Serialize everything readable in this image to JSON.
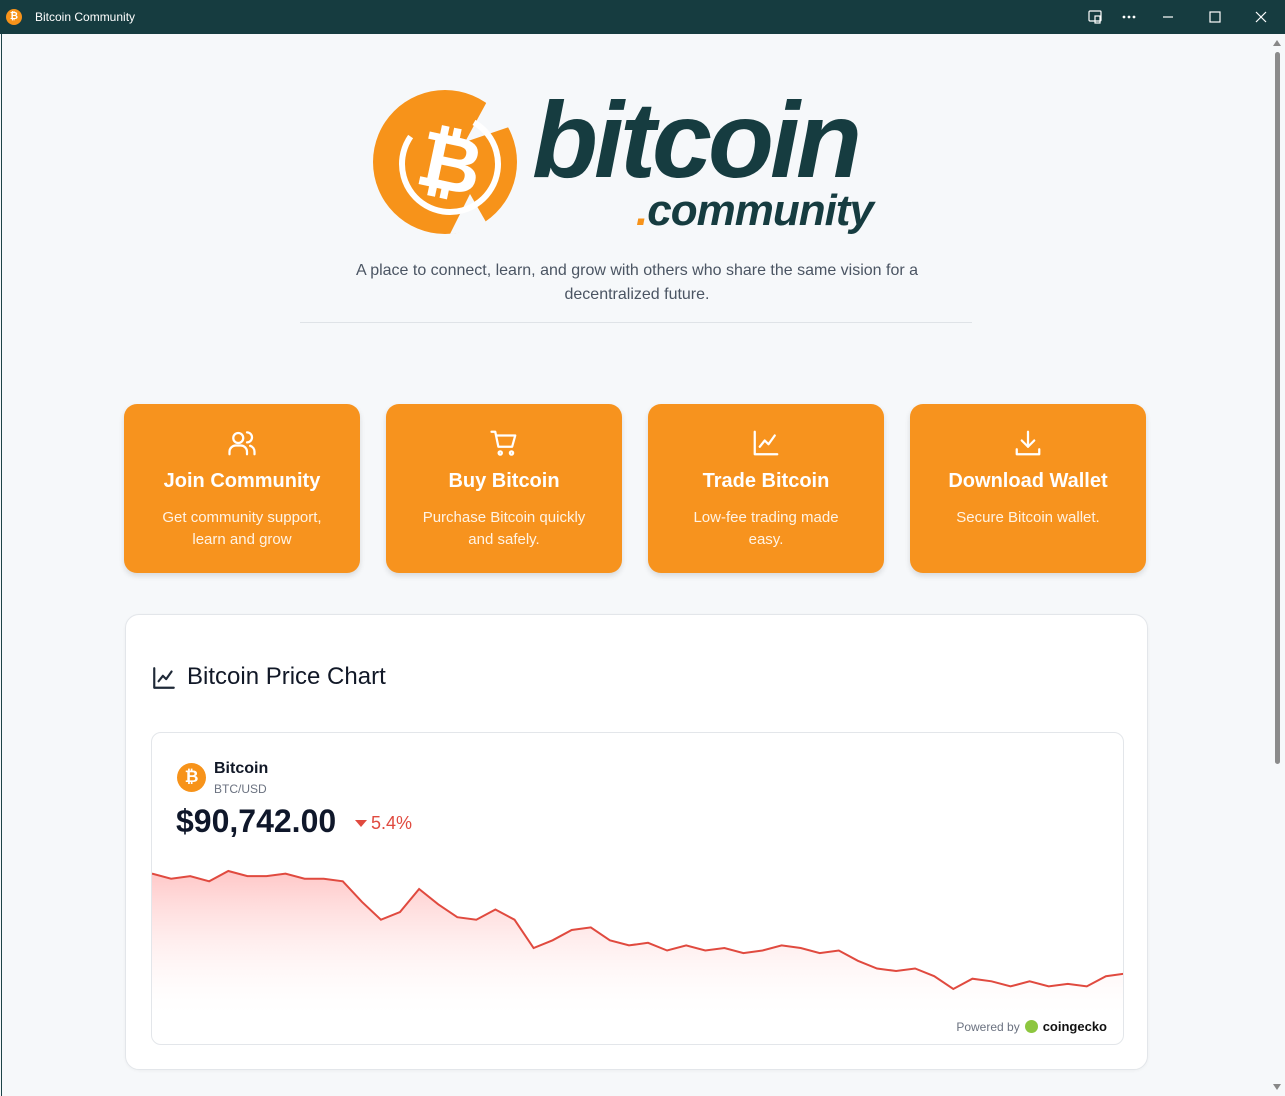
{
  "window": {
    "title": "Bitcoin Community",
    "controls": [
      "cast-icon",
      "more-icon",
      "minimize-icon",
      "maximize-icon",
      "close-icon"
    ]
  },
  "logo": {
    "symbol": "₿",
    "word": "bitcoin",
    "dot": ".",
    "sub": "community",
    "colors": {
      "orange": "#f7931a",
      "dark": "#163c40"
    }
  },
  "tagline": "A place to connect, learn, and grow with others who share the same vision for a decentralized future.",
  "cards": [
    {
      "icon": "users-icon",
      "title": "Join Community",
      "desc": "Get community support, learn and grow"
    },
    {
      "icon": "cart-icon",
      "title": "Buy Bitcoin",
      "desc": "Purchase Bitcoin quickly and safely."
    },
    {
      "icon": "line-chart-icon",
      "title": "Trade Bitcoin",
      "desc": "Low-fee trading made easy."
    },
    {
      "icon": "download-icon",
      "title": "Download Wallet",
      "desc": "Secure Bitcoin wallet."
    }
  ],
  "price_panel": {
    "title": "Bitcoin Price Chart",
    "widget": {
      "coin_symbol": "₿",
      "name": "Bitcoin",
      "pair": "BTC/USD",
      "price": "$90,742.00",
      "change": "5.4%",
      "change_direction": "down",
      "powered_label": "Powered by",
      "powered_brand": "coingecko"
    }
  },
  "chart_data": {
    "type": "area",
    "series": [
      {
        "values": [
          95.1,
          94.9,
          95.0,
          94.8,
          95.2,
          95.0,
          95.0,
          95.1,
          94.9,
          94.9,
          94.8,
          94.0,
          93.3,
          93.6,
          94.5,
          93.9,
          93.4,
          93.3,
          93.7,
          93.3,
          92.2,
          92.5,
          92.9,
          93.0,
          92.5,
          92.3,
          92.4,
          92.1,
          92.3,
          92.1,
          92.2,
          92.0,
          92.1,
          92.3,
          92.2,
          92.0,
          92.1,
          91.7,
          91.4,
          91.3,
          91.4,
          91.1,
          90.6,
          91.0,
          90.9,
          90.7,
          90.9,
          90.7,
          90.8,
          90.7,
          91.1,
          91.2
        ]
      }
    ],
    "colors": {
      "line": "#e04a3f",
      "fill": "#ffd2d2"
    },
    "grid": false
  }
}
